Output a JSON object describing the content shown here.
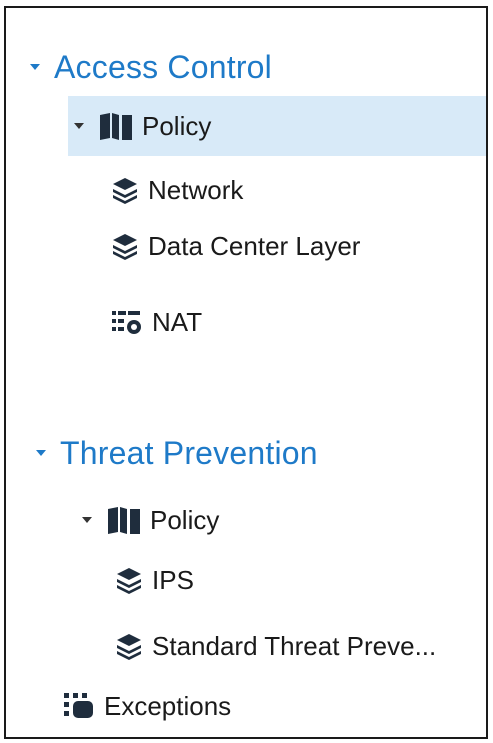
{
  "tree": {
    "access_control": {
      "title": "Access Control",
      "policy": {
        "label": "Policy",
        "layers": [
          {
            "label": "Network",
            "icon": "layers-icon"
          },
          {
            "label": "Data Center Layer",
            "icon": "layers-icon"
          }
        ]
      },
      "nat": {
        "label": "NAT",
        "icon": "nat-icon"
      }
    },
    "threat_prevention": {
      "title": "Threat Prevention",
      "policy": {
        "label": "Policy",
        "layers": [
          {
            "label": "IPS",
            "icon": "layers-icon"
          },
          {
            "label": "Standard Threat Preve...",
            "icon": "layers-icon"
          }
        ]
      },
      "exceptions": {
        "label": "Exceptions",
        "icon": "exceptions-icon"
      }
    }
  },
  "colors": {
    "section_title": "#1e7ac8",
    "selected_row": "#d8eaf8",
    "text": "#1a1a1a",
    "icon": "#1f2d3d"
  }
}
